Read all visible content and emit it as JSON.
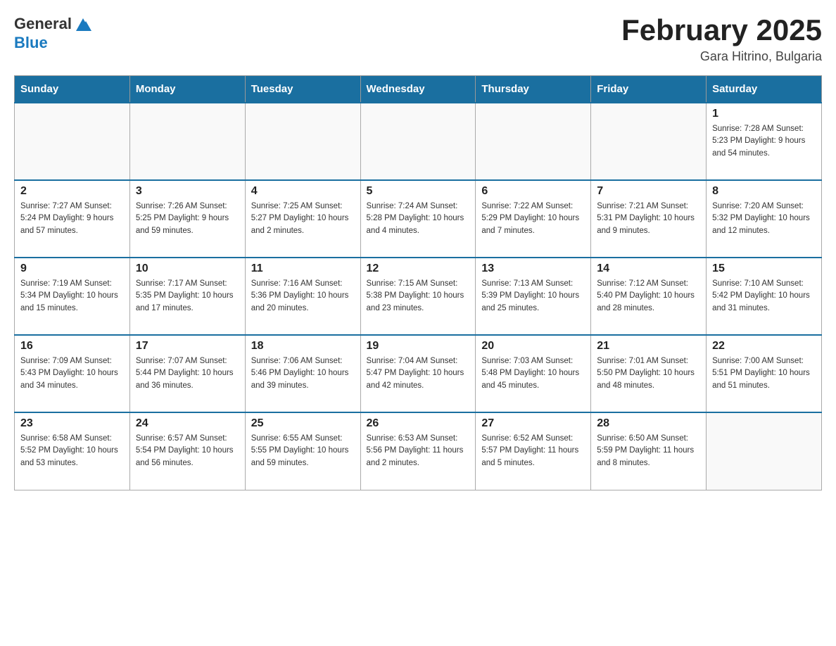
{
  "header": {
    "logo": {
      "general": "General",
      "blue": "Blue"
    },
    "title": "February 2025",
    "location": "Gara Hitrino, Bulgaria"
  },
  "days_of_week": [
    "Sunday",
    "Monday",
    "Tuesday",
    "Wednesday",
    "Thursday",
    "Friday",
    "Saturday"
  ],
  "weeks": [
    [
      {
        "day": "",
        "info": ""
      },
      {
        "day": "",
        "info": ""
      },
      {
        "day": "",
        "info": ""
      },
      {
        "day": "",
        "info": ""
      },
      {
        "day": "",
        "info": ""
      },
      {
        "day": "",
        "info": ""
      },
      {
        "day": "1",
        "info": "Sunrise: 7:28 AM\nSunset: 5:23 PM\nDaylight: 9 hours\nand 54 minutes."
      }
    ],
    [
      {
        "day": "2",
        "info": "Sunrise: 7:27 AM\nSunset: 5:24 PM\nDaylight: 9 hours\nand 57 minutes."
      },
      {
        "day": "3",
        "info": "Sunrise: 7:26 AM\nSunset: 5:25 PM\nDaylight: 9 hours\nand 59 minutes."
      },
      {
        "day": "4",
        "info": "Sunrise: 7:25 AM\nSunset: 5:27 PM\nDaylight: 10 hours\nand 2 minutes."
      },
      {
        "day": "5",
        "info": "Sunrise: 7:24 AM\nSunset: 5:28 PM\nDaylight: 10 hours\nand 4 minutes."
      },
      {
        "day": "6",
        "info": "Sunrise: 7:22 AM\nSunset: 5:29 PM\nDaylight: 10 hours\nand 7 minutes."
      },
      {
        "day": "7",
        "info": "Sunrise: 7:21 AM\nSunset: 5:31 PM\nDaylight: 10 hours\nand 9 minutes."
      },
      {
        "day": "8",
        "info": "Sunrise: 7:20 AM\nSunset: 5:32 PM\nDaylight: 10 hours\nand 12 minutes."
      }
    ],
    [
      {
        "day": "9",
        "info": "Sunrise: 7:19 AM\nSunset: 5:34 PM\nDaylight: 10 hours\nand 15 minutes."
      },
      {
        "day": "10",
        "info": "Sunrise: 7:17 AM\nSunset: 5:35 PM\nDaylight: 10 hours\nand 17 minutes."
      },
      {
        "day": "11",
        "info": "Sunrise: 7:16 AM\nSunset: 5:36 PM\nDaylight: 10 hours\nand 20 minutes."
      },
      {
        "day": "12",
        "info": "Sunrise: 7:15 AM\nSunset: 5:38 PM\nDaylight: 10 hours\nand 23 minutes."
      },
      {
        "day": "13",
        "info": "Sunrise: 7:13 AM\nSunset: 5:39 PM\nDaylight: 10 hours\nand 25 minutes."
      },
      {
        "day": "14",
        "info": "Sunrise: 7:12 AM\nSunset: 5:40 PM\nDaylight: 10 hours\nand 28 minutes."
      },
      {
        "day": "15",
        "info": "Sunrise: 7:10 AM\nSunset: 5:42 PM\nDaylight: 10 hours\nand 31 minutes."
      }
    ],
    [
      {
        "day": "16",
        "info": "Sunrise: 7:09 AM\nSunset: 5:43 PM\nDaylight: 10 hours\nand 34 minutes."
      },
      {
        "day": "17",
        "info": "Sunrise: 7:07 AM\nSunset: 5:44 PM\nDaylight: 10 hours\nand 36 minutes."
      },
      {
        "day": "18",
        "info": "Sunrise: 7:06 AM\nSunset: 5:46 PM\nDaylight: 10 hours\nand 39 minutes."
      },
      {
        "day": "19",
        "info": "Sunrise: 7:04 AM\nSunset: 5:47 PM\nDaylight: 10 hours\nand 42 minutes."
      },
      {
        "day": "20",
        "info": "Sunrise: 7:03 AM\nSunset: 5:48 PM\nDaylight: 10 hours\nand 45 minutes."
      },
      {
        "day": "21",
        "info": "Sunrise: 7:01 AM\nSunset: 5:50 PM\nDaylight: 10 hours\nand 48 minutes."
      },
      {
        "day": "22",
        "info": "Sunrise: 7:00 AM\nSunset: 5:51 PM\nDaylight: 10 hours\nand 51 minutes."
      }
    ],
    [
      {
        "day": "23",
        "info": "Sunrise: 6:58 AM\nSunset: 5:52 PM\nDaylight: 10 hours\nand 53 minutes."
      },
      {
        "day": "24",
        "info": "Sunrise: 6:57 AM\nSunset: 5:54 PM\nDaylight: 10 hours\nand 56 minutes."
      },
      {
        "day": "25",
        "info": "Sunrise: 6:55 AM\nSunset: 5:55 PM\nDaylight: 10 hours\nand 59 minutes."
      },
      {
        "day": "26",
        "info": "Sunrise: 6:53 AM\nSunset: 5:56 PM\nDaylight: 11 hours\nand 2 minutes."
      },
      {
        "day": "27",
        "info": "Sunrise: 6:52 AM\nSunset: 5:57 PM\nDaylight: 11 hours\nand 5 minutes."
      },
      {
        "day": "28",
        "info": "Sunrise: 6:50 AM\nSunset: 5:59 PM\nDaylight: 11 hours\nand 8 minutes."
      },
      {
        "day": "",
        "info": ""
      }
    ]
  ]
}
